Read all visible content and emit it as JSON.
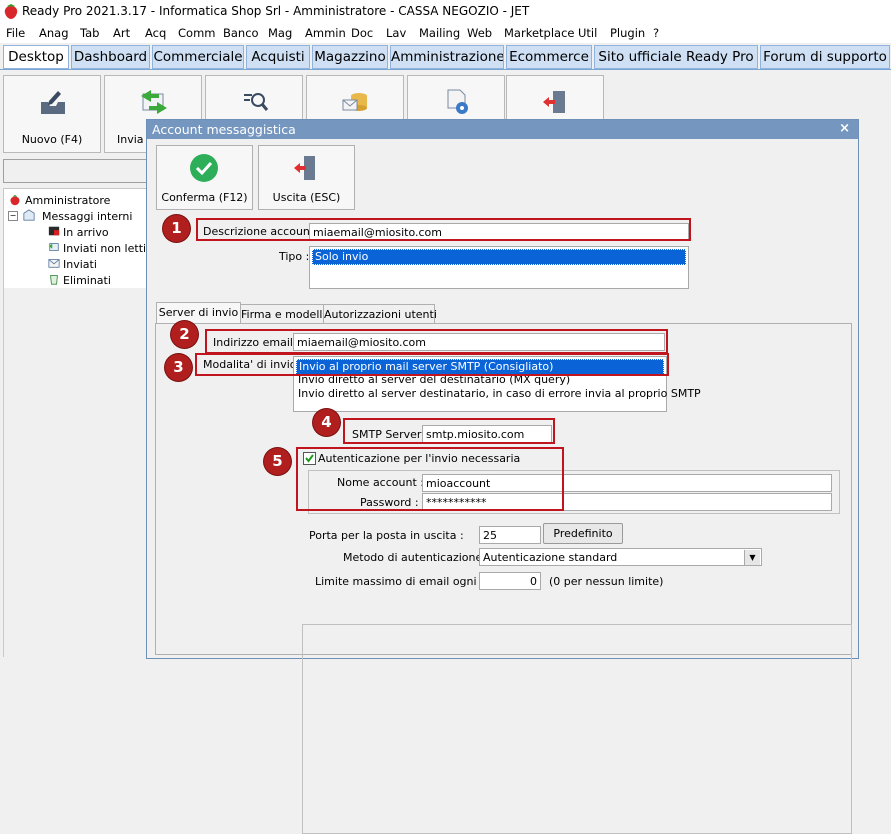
{
  "window": {
    "title": "Ready Pro 2021.3.17 - Informatica Shop Srl - Amministratore - CASSA NEGOZIO - JET"
  },
  "menu": [
    "File",
    "Anag",
    "Tab",
    "Art",
    "Acq",
    "Comm",
    "Banco",
    "Mag",
    "Ammin",
    "Doc",
    "Lav",
    "Mailing",
    "Web",
    "Marketplace",
    "Util",
    "Plugin",
    "?"
  ],
  "main_tabs": [
    "Desktop",
    "Dashboard",
    "Commerciale",
    "Acquisti",
    "Magazzino",
    "Amministrazione",
    "Ecommerce",
    "Sito ufficiale Ready Pro",
    "Forum di supporto"
  ],
  "toolbar": {
    "new_label": "Nuovo (F4)",
    "send_label": "Invia"
  },
  "tree": {
    "root": "Amministratore",
    "group": "Messaggi interni",
    "items": [
      "In arrivo",
      "Inviati non letti",
      "Inviati",
      "Eliminati"
    ]
  },
  "dialog": {
    "title": "Account messaggistica",
    "close": "×",
    "confirm_label": "Conferma (F12)",
    "exit_label": "Uscita (ESC)",
    "descr_label": "Descrizione account :",
    "descr_value": "miaemail@miosito.com",
    "tipo_label": "Tipo :",
    "tipo_options": [
      "Solo invio"
    ],
    "tabs": [
      "Server di invio",
      "Firma e modelli",
      "Autorizzazioni utenti"
    ],
    "email_label": "Indirizzo email :",
    "email_value": "miaemail@miosito.com",
    "mode_label": "Modalita' di invio :",
    "mode_options": [
      "Invio al proprio mail server SMTP (Consigliato)",
      "Invio diretto al server del destinatario (MX query)",
      "Invio diretto al server destinatario, in caso di errore invia al proprio SMTP"
    ],
    "smtp_label": "SMTP Server :",
    "smtp_value": "smtp.miosito.com",
    "auth_label": "Autenticazione per l'invio necessaria",
    "auth_checked": true,
    "account_label": "Nome account :",
    "account_value": "mioaccount",
    "password_label": "Password :",
    "password_value": "***********",
    "port_label": "Porta per la posta in uscita :",
    "port_value": "25",
    "default_button": "Predefinito",
    "method_label": "Metodo di autenticazione :",
    "method_value": "Autenticazione standard",
    "limit_label": "Limite massimo di email ogni ora :",
    "limit_value": "0",
    "limit_hint": "(0 per nessun limite)"
  },
  "badges": [
    "1",
    "2",
    "3",
    "4",
    "5"
  ],
  "colors": {
    "annotation_red": "#c0141e",
    "selection_blue": "#0a64d8",
    "dialog_title": "#7596bf"
  }
}
